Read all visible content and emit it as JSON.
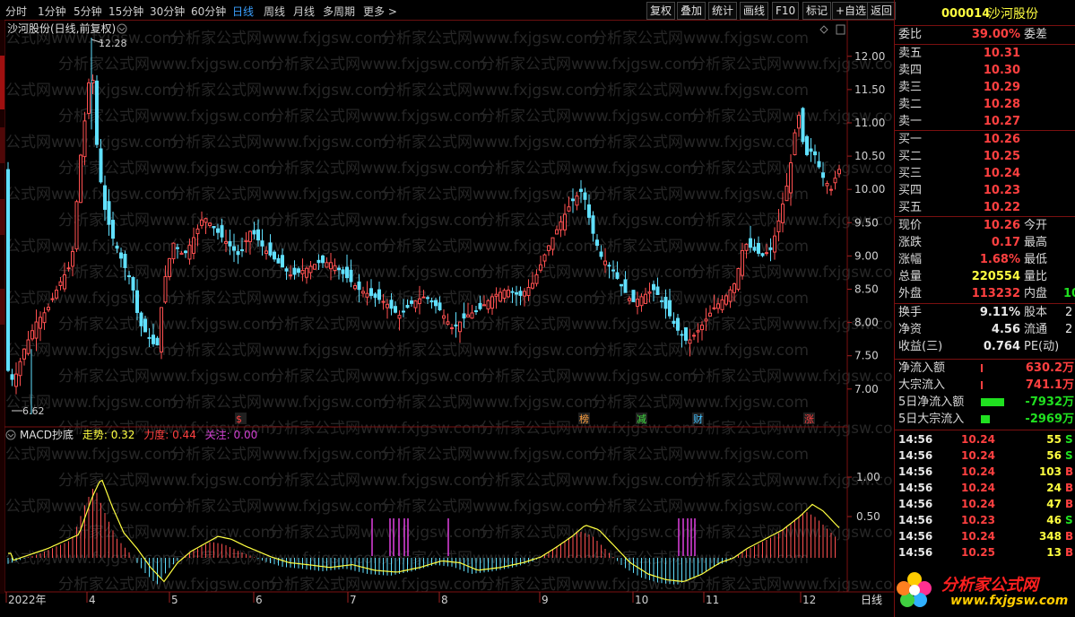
{
  "toolbar": {
    "periods": [
      "分时",
      "1分钟",
      "5分钟",
      "15分钟",
      "30分钟",
      "60分钟",
      "日线",
      "周线",
      "月线",
      "多周期",
      "更多 >"
    ],
    "active_period": "日线",
    "tools": [
      "复权",
      "叠加",
      "统计",
      "画线",
      "F10",
      "标记",
      "+自选",
      "返回"
    ]
  },
  "main_chart": {
    "title": "沙河股份(日线,前复权)",
    "high_label": "12.28",
    "low_label": "6.62",
    "y_ticks": [
      "12.00",
      "11.50",
      "11.00",
      "10.50",
      "10.00",
      "9.50",
      "9.00",
      "8.50",
      "8.00",
      "7.50",
      "7.00"
    ],
    "event_markers": [
      {
        "text": "$",
        "color": "#ff4040"
      },
      {
        "text": "榜",
        "color": "#ffa040"
      },
      {
        "text": "减",
        "color": "#40e040"
      },
      {
        "text": "财",
        "color": "#40c0ff"
      },
      {
        "text": "涨",
        "color": "#ff4040"
      }
    ],
    "watermark": "分析家公式网www.fxjgsw.com"
  },
  "indicator": {
    "name": "MACD抄底",
    "items": [
      {
        "label": "走势:",
        "value": "0.32",
        "color": "#ffff40"
      },
      {
        "label": "力度:",
        "value": "0.44",
        "color": "#ff4040"
      },
      {
        "label": "关注:",
        "value": "0.00",
        "color": "#d040d0"
      }
    ],
    "y_ticks": [
      "1.00",
      "0.50"
    ]
  },
  "x_axis": {
    "labels": [
      "2022年",
      "4",
      "5",
      "6",
      "7",
      "8",
      "9",
      "10",
      "11",
      "12"
    ],
    "period_tag": "日线"
  },
  "quote": {
    "code": "000014",
    "name": "沙河股份",
    "weibi_label": "委比",
    "weibi_value": "39.00%",
    "weicha_label": "委差",
    "sell": [
      {
        "label": "卖五",
        "price": "10.31"
      },
      {
        "label": "卖四",
        "price": "10.30"
      },
      {
        "label": "卖三",
        "price": "10.29"
      },
      {
        "label": "卖二",
        "price": "10.28"
      },
      {
        "label": "卖一",
        "price": "10.27"
      }
    ],
    "buy": [
      {
        "label": "买一",
        "price": "10.26"
      },
      {
        "label": "买二",
        "price": "10.25"
      },
      {
        "label": "买三",
        "price": "10.24"
      },
      {
        "label": "买四",
        "price": "10.23"
      },
      {
        "label": "买五",
        "price": "10.22"
      }
    ],
    "stats": [
      {
        "label": "现价",
        "value": "10.26",
        "color": "red",
        "label2": "今开"
      },
      {
        "label": "涨跌",
        "value": "0.17",
        "color": "red",
        "label2": "最高"
      },
      {
        "label": "涨幅",
        "value": "1.68%",
        "color": "red",
        "label2": "最低"
      },
      {
        "label": "总量",
        "value": "220554",
        "color": "yellow",
        "label2": "量比"
      },
      {
        "label": "外盘",
        "value": "113232",
        "color": "red",
        "label2": "内盘",
        "value2": "10"
      }
    ],
    "stats2": [
      {
        "label": "换手",
        "value": "9.11%",
        "label2": "股本",
        "value2": "2"
      },
      {
        "label": "净资",
        "value": "4.56",
        "label2": "流通",
        "value2": "2"
      },
      {
        "label": "收益(三)",
        "value": "0.764",
        "label2": "PE(动)",
        "value2": ""
      }
    ],
    "flows": [
      {
        "label": "净流入额",
        "value": "630.2万",
        "color": "red",
        "bar": "#ff4040",
        "barw": 2
      },
      {
        "label": "大宗流入",
        "value": "741.1万",
        "color": "red",
        "bar": "#ff4040",
        "barw": 2
      },
      {
        "label": "5日净流入额",
        "value": "-7932万",
        "color": "green",
        "bar": "#20e020",
        "barw": 26
      },
      {
        "label": "5日大宗流入",
        "value": "-2969万",
        "color": "green",
        "bar": "#20e020",
        "barw": 10
      }
    ],
    "ticks": [
      {
        "time": "14:56",
        "price": "10.24",
        "price_color": "red",
        "vol": "55",
        "dir": "S"
      },
      {
        "time": "14:56",
        "price": "10.24",
        "price_color": "red",
        "vol": "56",
        "dir": "S"
      },
      {
        "time": "14:56",
        "price": "10.24",
        "price_color": "red",
        "vol": "103",
        "dir": "B"
      },
      {
        "time": "14:56",
        "price": "10.24",
        "price_color": "red",
        "vol": "24",
        "dir": "B"
      },
      {
        "time": "14:56",
        "price": "10.24",
        "price_color": "red",
        "vol": "47",
        "dir": "B"
      },
      {
        "time": "14:56",
        "price": "10.23",
        "price_color": "red",
        "vol": "46",
        "dir": "S"
      },
      {
        "time": "14:56",
        "price": "10.24",
        "price_color": "red",
        "vol": "348",
        "dir": "B"
      },
      {
        "time": "14:56",
        "price": "10.25",
        "price_color": "red",
        "vol": "13",
        "dir": "B"
      }
    ],
    "logo_text": "分析家公式网",
    "logo_url": "www.fxjgsw.com"
  }
}
